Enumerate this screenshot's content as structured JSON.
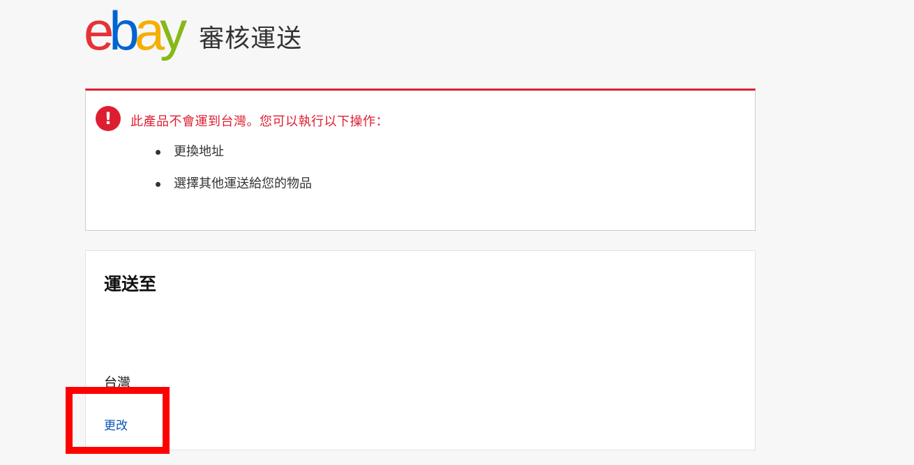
{
  "header": {
    "logo": {
      "letters": [
        "e",
        "b",
        "a",
        "y"
      ],
      "colors": [
        "#e53238",
        "#0064d2",
        "#f5af02",
        "#86b817"
      ]
    },
    "title": "審核運送"
  },
  "alert": {
    "icon": "exclamation-circle-icon",
    "icon_glyph": "!",
    "message": "此產品不會運到台灣。您可以執行以下操作：",
    "options": [
      "更換地址",
      "選擇其他運送給您的物品"
    ],
    "color": "#dd1e31"
  },
  "shipping": {
    "heading": "運送至",
    "country": "台灣",
    "change_label": "更改",
    "link_color": "#0654ba"
  },
  "annotation": {
    "highlight_color": "#ff0000"
  }
}
